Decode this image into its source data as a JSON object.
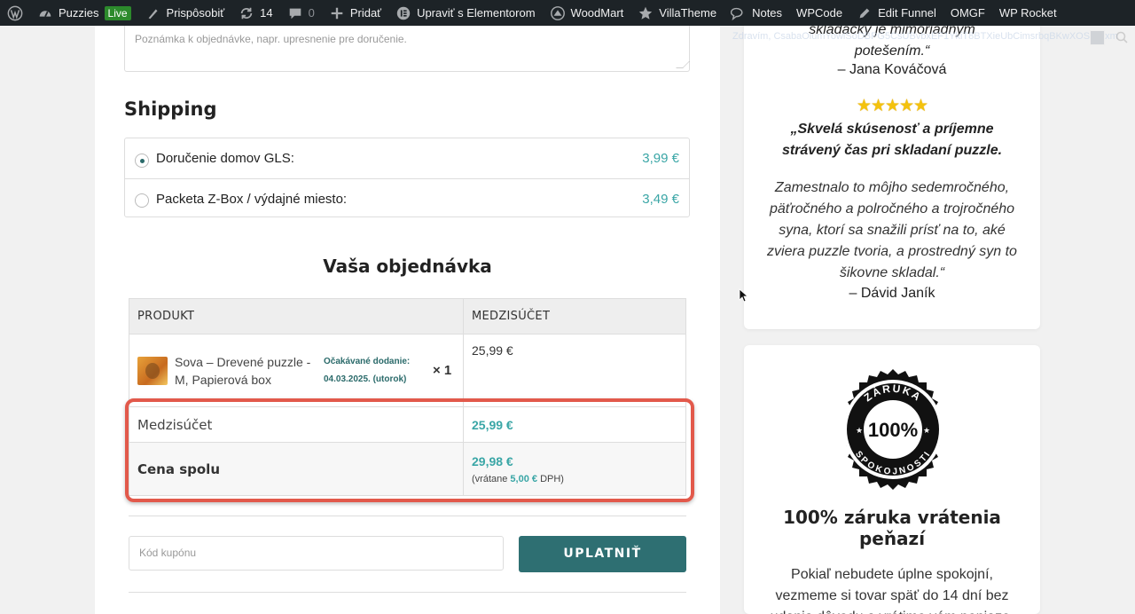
{
  "adminbar": {
    "items": [
      {
        "label": "Puzzies",
        "icon": "dashboard-icon"
      },
      {
        "label": "Prispôsobiť",
        "icon": "brush-icon"
      },
      {
        "label": "14",
        "icon": "updates-icon"
      },
      {
        "label": "0",
        "icon": "comment-icon"
      },
      {
        "label": "Pridať",
        "icon": "plus-icon"
      },
      {
        "label": "Upraviť s Elementorom",
        "icon": "elementor-icon"
      },
      {
        "label": "WoodMart",
        "icon": "woodmart-icon"
      },
      {
        "label": "VillaTheme",
        "icon": "star-icon"
      },
      {
        "label": "Notes",
        "icon": "notes-icon"
      },
      {
        "label": "WPCode"
      },
      {
        "label": "Edit Funnel",
        "icon": "edit-icon"
      },
      {
        "label": "OMGF"
      },
      {
        "label": "WP Rocket"
      }
    ],
    "live_badge": "Live",
    "user_greeting": "Zdravím, CsabaOlumYowlSoDBPG5CsUBvbxEF1YkiT8BTXieUbCimsrbqBKwXOSEYlxm"
  },
  "checkout": {
    "order_note_placeholder": "Poznámka k objednávke, napr. upresnenie pre doručenie.",
    "shipping_title": "Shipping",
    "shipping_options": [
      {
        "label": "Doručenie domov GLS:",
        "price": "3,99 €",
        "selected": true
      },
      {
        "label": "Packeta Z-Box / výdajné miesto:",
        "price": "3,49 €",
        "selected": false
      }
    ],
    "order_title": "Vaša objednávka",
    "table": {
      "col_product": "PRODUKT",
      "col_subtotal": "MEDZISÚČET",
      "item": {
        "name": "Sova – Drevené puzzle - M, Papierová box",
        "delivery_label": "Očakávané dodanie:",
        "delivery_date": "04.03.2025. (utorok)",
        "qty": "× 1",
        "subtotal": "25,99 €"
      },
      "subtotal_label": "Medzisúčet",
      "subtotal_value": "25,99 €",
      "total_label": "Cena spolu",
      "total_value": "29,98 €",
      "tax_prefix": "(vrátane",
      "tax_value": "5,00 €",
      "tax_suffix": "DPH)"
    },
    "coupon_placeholder": "Kód kupónu",
    "apply_button": "UPLATNIŤ"
  },
  "sidebar": {
    "review1_tail": "skladácky je mimoriadnym potešením.“",
    "review1_author": "– Jana Kováčová",
    "review2_stars": 5,
    "review2_title": "„Skvelá skúsenosť a príjemne strávený čas pri skladaní puzzle.",
    "review2_body": "Zamestnalo to môjho sedemročného, päťročného a polročného a trojročného syna, ktorí sa snažili prísť na to, aké zviera puzzle tvoria, a prostredný syn to šikovne skladal.“",
    "review2_author": "– Dávid Janík",
    "badge_top": "ZÁRUKA",
    "badge_center": "100%",
    "badge_bottom": "SPOKOJNOSTI",
    "guarantee_title": "100% záruka vrátenia peňazí",
    "guarantee_body": "Pokiaľ nebudete úplne spokojní, vezmeme si tovar späť do 14 dní bez udania dôvodu a vrátime vám peniaze."
  },
  "colors": {
    "accent": "#3aa6a6",
    "button": "#2e6f72",
    "highlight": "#e2594b",
    "adminbar": "#1d2327"
  }
}
